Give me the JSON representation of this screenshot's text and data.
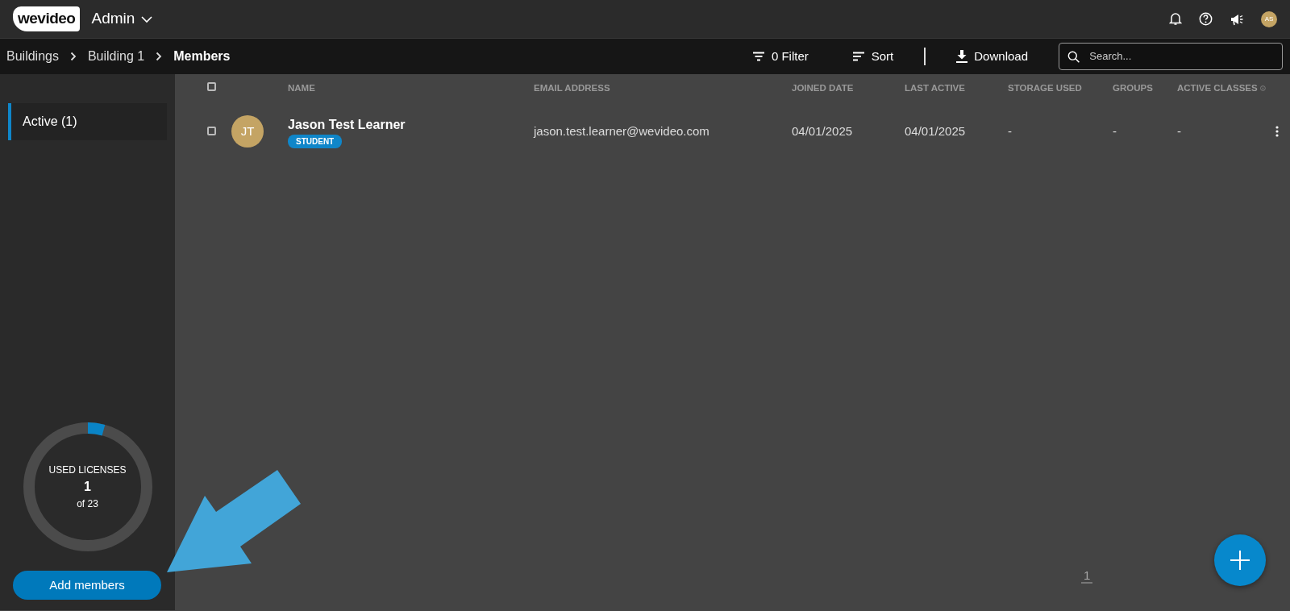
{
  "topbar": {
    "logo": "wevideo",
    "title": "Admin",
    "avatar": "AS"
  },
  "breadcrumbs": [
    {
      "label": "Buildings",
      "current": false
    },
    {
      "label": "Building 1",
      "current": false
    },
    {
      "label": "Members",
      "current": true
    }
  ],
  "toolbar": {
    "filter": "0 Filter",
    "sort": "Sort",
    "download": "Download",
    "search": {
      "placeholder": "Search..."
    }
  },
  "sidebar": {
    "items": [
      {
        "label": "Active (1)",
        "selected": true
      }
    ],
    "licenses": {
      "title": "USED LICENSES",
      "count": "1",
      "total": "of 23",
      "level": 0.043
    },
    "add_button": "Add members"
  },
  "table": {
    "select_all": {
      "checked": false
    },
    "columns": [
      "NAME",
      "EMAIL ADDRESS",
      "JOINED DATE",
      "LAST ACTIVE",
      "STORAGE USED",
      "GROUPS",
      "ACTIVE CLASSES"
    ],
    "rows": [
      {
        "checked": false,
        "initials": "JT",
        "name": "Jason Test Learner",
        "role": "STUDENT",
        "email": "jason.test.learner@wevideo.com",
        "joined": "04/01/2025",
        "last_active": "04/01/2025",
        "storage": "-",
        "groups": "-",
        "active_classes": "-"
      }
    ]
  },
  "pagination": [
    {
      "label": "1",
      "selected": true
    }
  ],
  "annotations": [
    {
      "kind": "arrow"
    }
  ]
}
